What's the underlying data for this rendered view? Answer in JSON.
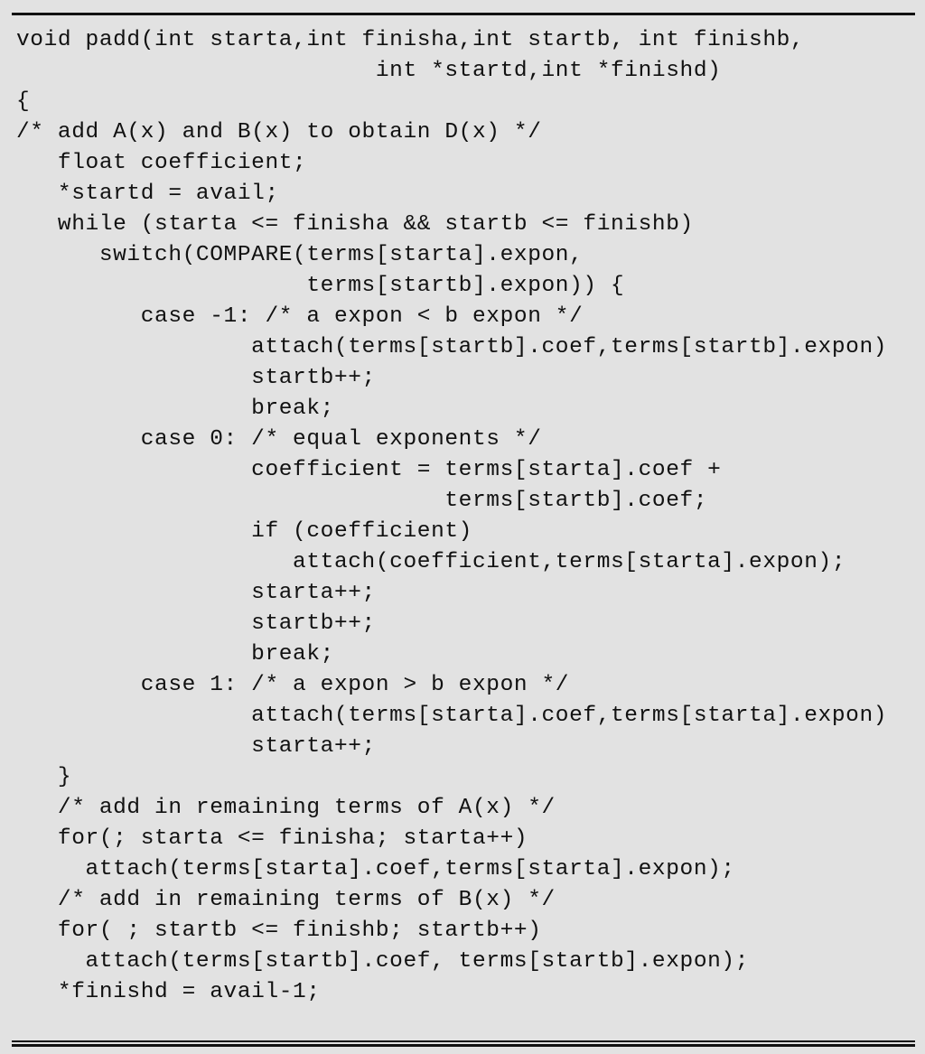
{
  "figure": {
    "background_color": "#e2e2e2",
    "text_color": "#111111",
    "rule_color": "#111111",
    "language": "C",
    "function_name": "padd"
  },
  "code": {
    "lines": [
      "void padd(int starta,int finisha,int startb, int finishb,",
      "                          int *startd,int *finishd)",
      "{",
      "/* add A(x) and B(x) to obtain D(x) */",
      "   float coefficient;",
      "   *startd = avail;",
      "   while (starta <= finisha && startb <= finishb)",
      "      switch(COMPARE(terms[starta].expon,",
      "                     terms[startb].expon)) {",
      "         case -1: /* a expon < b expon */",
      "                 attach(terms[startb].coef,terms[startb].expon)",
      "                 startb++;",
      "                 break;",
      "         case 0: /* equal exponents */",
      "                 coefficient = terms[starta].coef +",
      "                               terms[startb].coef;",
      "                 if (coefficient)",
      "                    attach(coefficient,terms[starta].expon);",
      "                 starta++;",
      "                 startb++;",
      "                 break;",
      "         case 1: /* a expon > b expon */",
      "                 attach(terms[starta].coef,terms[starta].expon)",
      "                 starta++;",
      "   }",
      "   /* add in remaining terms of A(x) */",
      "   for(; starta <= finisha; starta++)",
      "     attach(terms[starta].coef,terms[starta].expon);",
      "   /* add in remaining terms of B(x) */",
      "   for( ; startb <= finishb; startb++)",
      "     attach(terms[startb].coef, terms[startb].expon);",
      "   *finishd = avail-1;",
      "}"
    ]
  }
}
